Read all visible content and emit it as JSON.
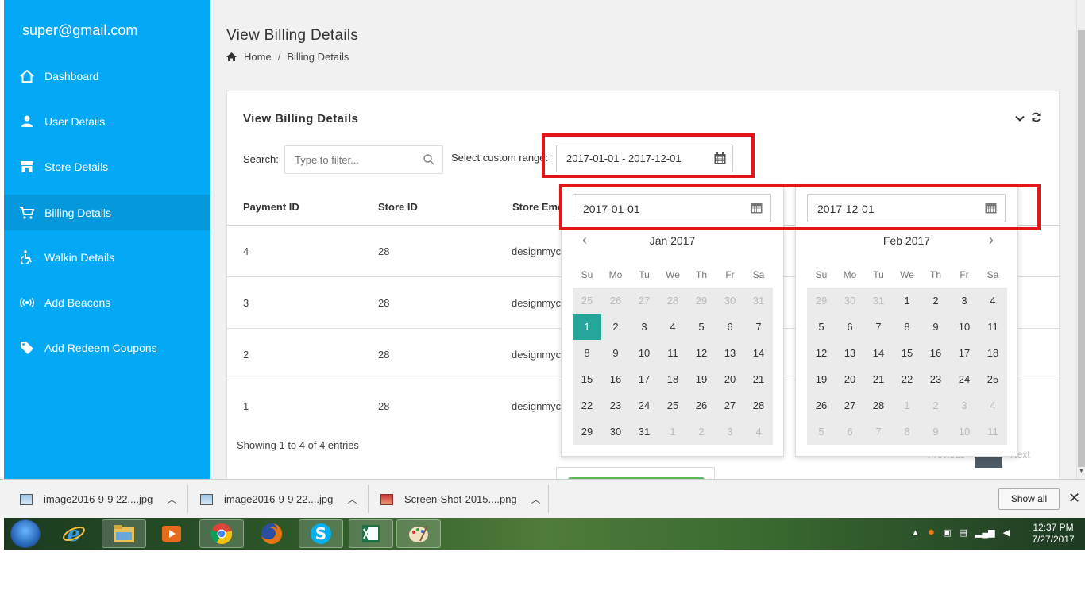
{
  "sidebar": {
    "user": "super@gmail.com",
    "items": [
      {
        "label": "Dashboard",
        "icon": "home-icon"
      },
      {
        "label": "User Details",
        "icon": "user-icon"
      },
      {
        "label": "Store Details",
        "icon": "store-icon"
      },
      {
        "label": "Billing Details",
        "icon": "cart-icon",
        "active": true
      },
      {
        "label": "Walkin Details",
        "icon": "wheelchair-icon"
      },
      {
        "label": "Add Beacons",
        "icon": "broadcast-icon"
      },
      {
        "label": "Add Redeem Coupons",
        "icon": "tag-icon"
      }
    ]
  },
  "page": {
    "title": "View Billing Details",
    "breadcrumb": {
      "home": "Home",
      "separator": "/",
      "current": "Billing Details"
    }
  },
  "card": {
    "title": "View Billing Details",
    "search_label": "Search:",
    "search_placeholder": "Type to filter...",
    "range_label": "Select custom range:",
    "range_value": "2017-01-01 - 2017-12-01",
    "columns": [
      "Payment ID",
      "Store ID",
      "Store Ema"
    ],
    "rows": [
      {
        "payment_id": "4",
        "store_id": "28",
        "store_email": "designmyc"
      },
      {
        "payment_id": "3",
        "store_id": "28",
        "store_email": "designmyc"
      },
      {
        "payment_id": "2",
        "store_id": "28",
        "store_email": "designmyc"
      },
      {
        "payment_id": "1",
        "store_id": "28",
        "store_email": "designmyc"
      }
    ],
    "entries": "Showing 1 to 4 of 4 entries",
    "pager": {
      "previous": "Previous",
      "next": "Next"
    }
  },
  "datepicker": {
    "weekdays": [
      "Su",
      "Mo",
      "Tu",
      "We",
      "Th",
      "Fr",
      "Sa"
    ],
    "left": {
      "input": "2017-01-01",
      "month": "Jan 2017",
      "prev": "‹",
      "selected": "1",
      "weeks": [
        [
          "25",
          "26",
          "27",
          "28",
          "29",
          "30",
          "31"
        ],
        [
          "1",
          "2",
          "3",
          "4",
          "5",
          "6",
          "7"
        ],
        [
          "8",
          "9",
          "10",
          "11",
          "12",
          "13",
          "14"
        ],
        [
          "15",
          "16",
          "17",
          "18",
          "19",
          "20",
          "21"
        ],
        [
          "22",
          "23",
          "24",
          "25",
          "26",
          "27",
          "28"
        ],
        [
          "29",
          "30",
          "31",
          "1",
          "2",
          "3",
          "4"
        ]
      ],
      "off": [
        [
          0,
          0
        ],
        [
          0,
          1
        ],
        [
          0,
          2
        ],
        [
          0,
          3
        ],
        [
          0,
          4
        ],
        [
          0,
          5
        ],
        [
          0,
          6
        ],
        [
          5,
          3
        ],
        [
          5,
          4
        ],
        [
          5,
          5
        ],
        [
          5,
          6
        ]
      ]
    },
    "right": {
      "input": "2017-12-01",
      "month": "Feb 2017",
      "next": "›",
      "weeks": [
        [
          "29",
          "30",
          "31",
          "1",
          "2",
          "3",
          "4"
        ],
        [
          "5",
          "6",
          "7",
          "8",
          "9",
          "10",
          "11"
        ],
        [
          "12",
          "13",
          "14",
          "15",
          "16",
          "17",
          "18"
        ],
        [
          "19",
          "20",
          "21",
          "22",
          "23",
          "24",
          "25"
        ],
        [
          "26",
          "27",
          "28",
          "1",
          "2",
          "3",
          "4"
        ],
        [
          "5",
          "6",
          "7",
          "8",
          "9",
          "10",
          "11"
        ]
      ],
      "off": [
        [
          0,
          0
        ],
        [
          0,
          1
        ],
        [
          0,
          2
        ],
        [
          4,
          3
        ],
        [
          4,
          4
        ],
        [
          4,
          5
        ],
        [
          4,
          6
        ],
        [
          5,
          0
        ],
        [
          5,
          1
        ],
        [
          5,
          2
        ],
        [
          5,
          3
        ],
        [
          5,
          4
        ],
        [
          5,
          5
        ],
        [
          5,
          6
        ]
      ]
    }
  },
  "downloads": {
    "items": [
      "image2016-9-9 22....jpg",
      "image2016-9-9 22....jpg",
      "Screen-Shot-2015....png"
    ],
    "show_all": "Show all",
    "close": "✕"
  },
  "taskbar": {
    "apps": [
      "ie-icon",
      "explorer-icon",
      "media-player-icon",
      "chrome-icon",
      "firefox-icon",
      "skype-icon",
      "excel-icon",
      "paint-icon"
    ],
    "time": "12:37 PM",
    "date": "7/27/2017"
  },
  "colors": {
    "sidebar": "#03a9f4",
    "selected_day": "#26a69a",
    "highlight": "#e3161b"
  }
}
